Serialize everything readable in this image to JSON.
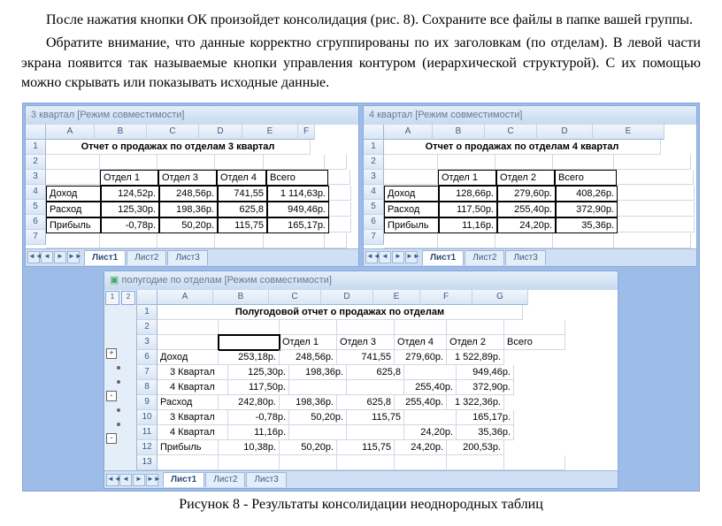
{
  "paragraphs": {
    "p1": "После нажатия кнопки ОК произойдет консолидация (рис. 8). Сохраните все файлы в папке вашей группы.",
    "p2": "Обратите внимание, что данные корректно сгруппированы по их заголовкам (по отделам). В левой части экрана появится так называемые кнопки управления контуром (иерархической структурой). С их помощью можно скрывать или показывать исходные данные."
  },
  "caption": "Рисунок 8 - Результаты консолидации неоднородных таблиц",
  "wb1": {
    "title": "3 квартал  [Режим совместимости]",
    "cols": [
      "A",
      "B",
      "C",
      "D",
      "E",
      "F"
    ],
    "cw": [
      54,
      58,
      58,
      48,
      62,
      18
    ],
    "titlerow": "Отчет о продажах по отделам 3 квартал",
    "headers": [
      "",
      "Отдел 1",
      "Отдел 3",
      "Отдел 4",
      "Всего"
    ],
    "rows": [
      {
        "n": "4",
        "l": "Доход",
        "v": [
          "124,52р.",
          "248,56р.",
          "741,55",
          "1 114,63р."
        ]
      },
      {
        "n": "5",
        "l": "Расход",
        "v": [
          "125,30р.",
          "198,36р.",
          "625,8",
          "949,46р."
        ]
      },
      {
        "n": "6",
        "l": "Прибыль",
        "v": [
          "-0,78р.",
          "50,20р.",
          "115,75",
          "165,17р."
        ]
      }
    ],
    "sheets": [
      "Лист1",
      "Лист2",
      "Лист3"
    ]
  },
  "wb2": {
    "title": "4 квартал  [Режим совместимости]",
    "cols": [
      "A",
      "B",
      "C",
      "D",
      "E"
    ],
    "cw": [
      54,
      58,
      58,
      62,
      80
    ],
    "titlerow": "Отчет о продажах по отделам 4 квартал",
    "headers": [
      "",
      "Отдел 1",
      "Отдел 2",
      "Всего"
    ],
    "rows": [
      {
        "n": "4",
        "l": "Доход",
        "v": [
          "128,66р.",
          "279,60р.",
          "408,26р."
        ]
      },
      {
        "n": "5",
        "l": "Расход",
        "v": [
          "117,50р.",
          "255,40р.",
          "372,90р."
        ]
      },
      {
        "n": "6",
        "l": "Прибыль",
        "v": [
          "11,16р.",
          "24,20р.",
          "35,36р."
        ]
      }
    ],
    "sheets": [
      "Лист1",
      "Лист2",
      "Лист3"
    ]
  },
  "wb3": {
    "title": "полугодие по отделам  [Режим совместимости]",
    "cols": [
      "A",
      "B",
      "C",
      "D",
      "E",
      "F",
      "G"
    ],
    "cw": [
      62,
      62,
      58,
      58,
      52,
      58,
      62
    ],
    "titlerow": "Полугодовой отчет о продажах по отделам",
    "headers": [
      "",
      "Отдел 1",
      "Отдел 3",
      "Отдел 4",
      "Отдел 2",
      "Всего"
    ],
    "rows": [
      {
        "n": "6",
        "o": "+",
        "l": "Доход",
        "v": [
          "253,18р.",
          "248,56р.",
          "741,55",
          "279,60р.",
          "1 522,89р."
        ]
      },
      {
        "n": "7",
        "o": ".",
        "l": "3 Квартал",
        "v": [
          "125,30р.",
          "198,36р.",
          "625,8",
          "",
          "949,46р."
        ]
      },
      {
        "n": "8",
        "o": ".",
        "l": "4 Квартал",
        "v": [
          "117,50р.",
          "",
          "",
          "255,40р.",
          "372,90р."
        ]
      },
      {
        "n": "9",
        "o": "-",
        "l": "Расход",
        "v": [
          "242,80р.",
          "198,36р.",
          "625,8",
          "255,40р.",
          "1 322,36р."
        ]
      },
      {
        "n": "10",
        "o": ".",
        "l": "3 Квартал",
        "v": [
          "-0,78р.",
          "50,20р.",
          "115,75",
          "",
          "165,17р."
        ]
      },
      {
        "n": "11",
        "o": ".",
        "l": "4 Квартал",
        "v": [
          "11,16р.",
          "",
          "",
          "24,20р.",
          "35,36р."
        ]
      },
      {
        "n": "12",
        "o": "-",
        "l": "Прибыль",
        "v": [
          "10,38р.",
          "50,20р.",
          "115,75",
          "24,20р.",
          "200,53р."
        ]
      }
    ],
    "sheets": [
      "Лист1",
      "Лист2",
      "Лист3"
    ]
  },
  "outline_levels": [
    "1",
    "2"
  ]
}
